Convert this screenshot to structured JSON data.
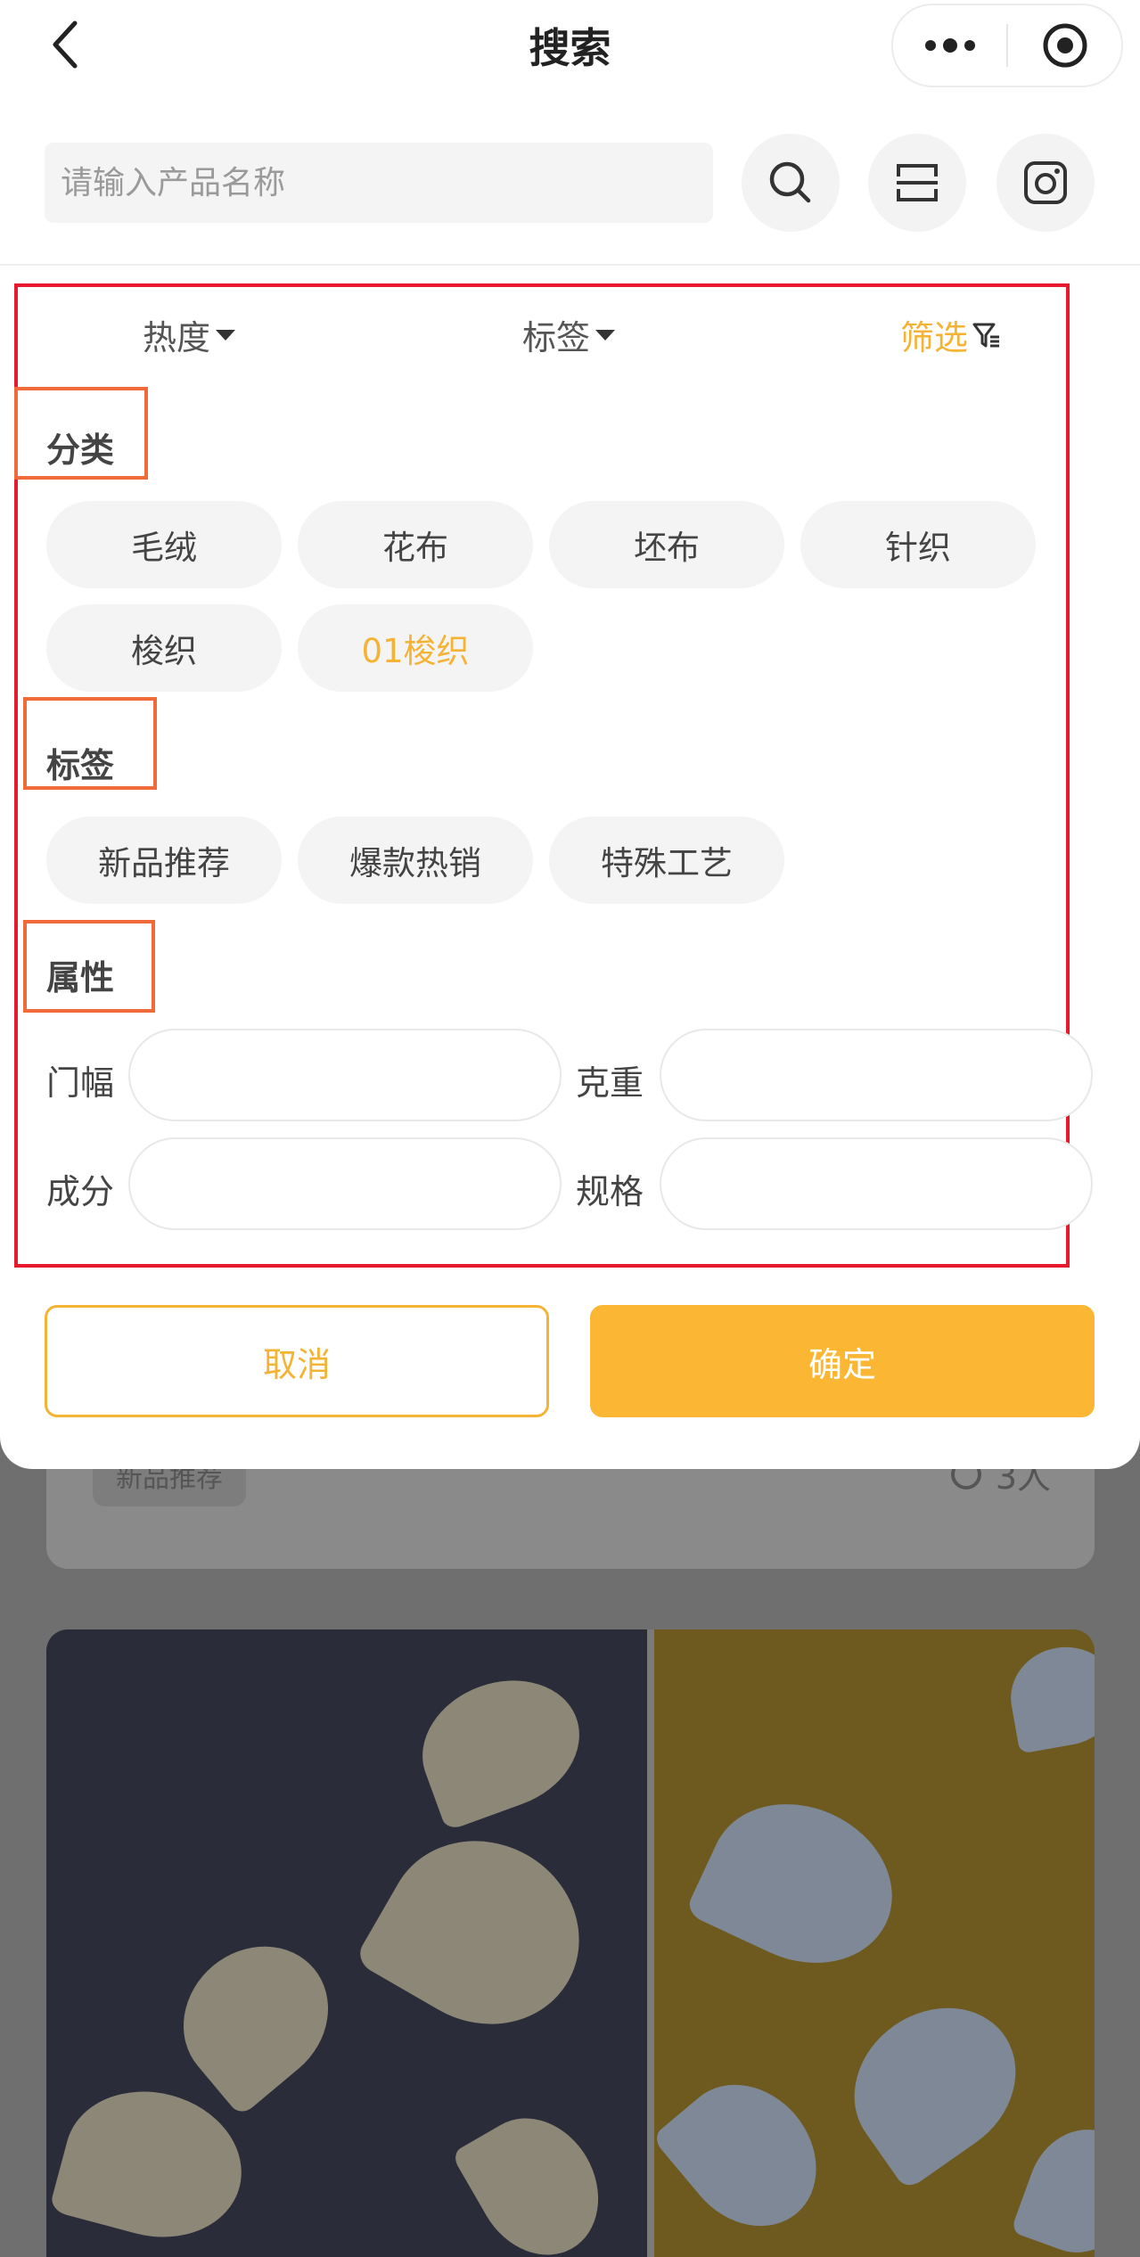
{
  "header": {
    "title": "搜索"
  },
  "search": {
    "placeholder": "请输入产品名称"
  },
  "sort_tabs": {
    "heat": "热度",
    "tags": "标签",
    "filter": "筛选"
  },
  "category": {
    "title": "分类",
    "chips": [
      "毛绒",
      "花布",
      "坯布",
      "针织",
      "梭织",
      "01梭织"
    ],
    "selected": "01梭织"
  },
  "tags": {
    "title": "标签",
    "chips": [
      "新品推荐",
      "爆款热销",
      "特殊工艺"
    ]
  },
  "attributes": {
    "title": "属性",
    "width_label": "门幅",
    "weight_label": "克重",
    "composition_label": "成分",
    "spec_label": "规格"
  },
  "actions": {
    "cancel": "取消",
    "confirm": "确定"
  },
  "background_card": {
    "tag": "新品推荐",
    "count": "3人"
  },
  "colors": {
    "accent": "#fbb734",
    "annotation_red": "#e8192c",
    "annotation_orange": "#f06a3a"
  }
}
